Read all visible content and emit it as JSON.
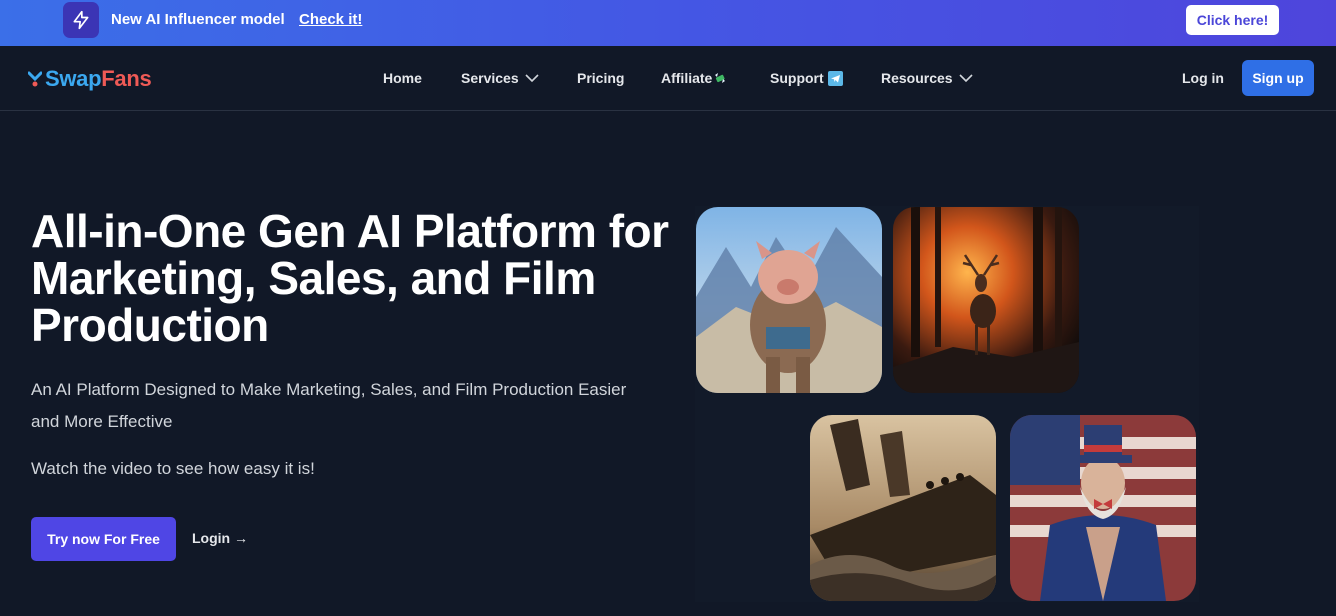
{
  "banner": {
    "icon": "lightning-icon",
    "text": "New AI Influencer model",
    "link": "Check it!",
    "button": "Click here!"
  },
  "brand": {
    "logo_part1": "Swap",
    "logo_part2": "Fans",
    "color_primary": "#3ba8f0",
    "color_secondary": "#ef5a56"
  },
  "nav": {
    "items": [
      {
        "label": "Home",
        "dropdown": false
      },
      {
        "label": "Services",
        "dropdown": true
      },
      {
        "label": "Pricing",
        "dropdown": false
      },
      {
        "label": "Affiliate",
        "dropdown": false,
        "icon": "money-wings-icon"
      },
      {
        "label": "Support",
        "dropdown": false,
        "icon": "telegram-icon"
      },
      {
        "label": "Resources",
        "dropdown": true
      }
    ],
    "login": "Log in",
    "signup": "Sign up"
  },
  "hero": {
    "title": "All-in-One Gen AI Platform for Marketing, Sales, and Film Production",
    "subtitle": "An AI Platform Designed to Make Marketing, Sales, and Film Production Easier and More Effective",
    "watch": "Watch the video to see how easy it is!",
    "cta": "Try now For Free",
    "login": "Login →"
  },
  "gallery": {
    "images": [
      "pig-warrior-image",
      "burning-forest-deer-image",
      "sinking-ship-image",
      "uncle-sam-image"
    ]
  },
  "colors": {
    "background": "#111827",
    "accent": "#4f46e5",
    "signup": "#2f6fe6"
  }
}
